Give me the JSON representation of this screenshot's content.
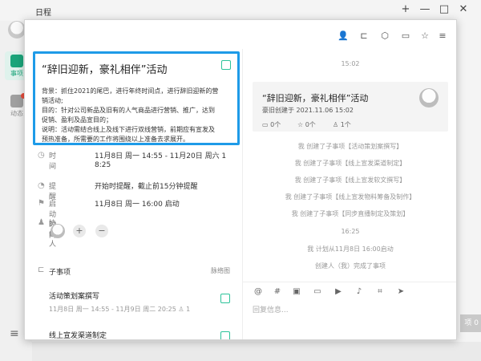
{
  "app": {
    "title": "日程",
    "window_controls": [
      "+",
      "—",
      "□",
      "✕"
    ],
    "nav": [
      {
        "label": "事项",
        "icon": "calendar-check-icon",
        "active": true
      },
      {
        "label": "动态",
        "icon": "activity-icon",
        "active": false
      }
    ],
    "bottom_right_label": "项 0"
  },
  "toolbar_icons": [
    "people-icon",
    "subtask-icon",
    "cube-icon",
    "folder-icon",
    "star-icon",
    "menu-icon"
  ],
  "task": {
    "title": "“辞旧迎新，豪礼相伴”活动",
    "desc_lines": [
      "背景：抓住2021的尾巴，进行年终时间点，进行辞旧迎新的营",
      "销活动;",
      "目的：针对公司新品及旧有的人气商品进行营销、推广，达到",
      "促销、盈利及品宣目的；",
      "说明：活动需结合线上及线下进行双线营销，前期应有宣发及",
      "预热准备，所需要的工作将围绕以上准备去求展开。"
    ],
    "time_label": "时间",
    "time_value_1": "11月8日 周一 14:55 - 11月20日 周六 1",
    "time_value_2": "8:25",
    "remind_label": "提醒",
    "remind_value": "开始时提醒，截止前15分钟提醒",
    "start_label": "启动时间",
    "start_value": "11月8日 周一 16:00 启动",
    "collab_label": "协作人",
    "add_btn": "+",
    "remove_btn": "−",
    "subtasks_label": "子事项",
    "mindmap_label": "脉络图",
    "subtasks": [
      {
        "title": "活动策划案撰写",
        "meta": "11月8日 周一 14:55 - 11月9日 周二 20:25",
        "count": "1"
      },
      {
        "title": "线上宣发渠道制定",
        "meta": "",
        "count": ""
      }
    ]
  },
  "feed": {
    "top_time": "15:02",
    "card": {
      "title": "“辞旧迎新，豪礼相伴”活动",
      "meta": "豪旧创建于 2021.11.06 15:02",
      "files": "0个",
      "stars": "0个",
      "people": "1个"
    },
    "activities_1": [
      "我 创建了子事项【活动策划案撰写】",
      "我 创建了子事项【线上宣发渠道制定】",
      "我 创建了子事项【线上宣发软文撰写】",
      "我 创建了子事项【线上宣发物料筹备及制作】",
      "我 创建了子事项【同步直播制定及策划】"
    ],
    "second_time": "16:25",
    "activities_2": [
      "我 计划从11月8日 16:00启动",
      "创建人（我）完成了事项"
    ],
    "reply_placeholder": "回复信息..."
  }
}
